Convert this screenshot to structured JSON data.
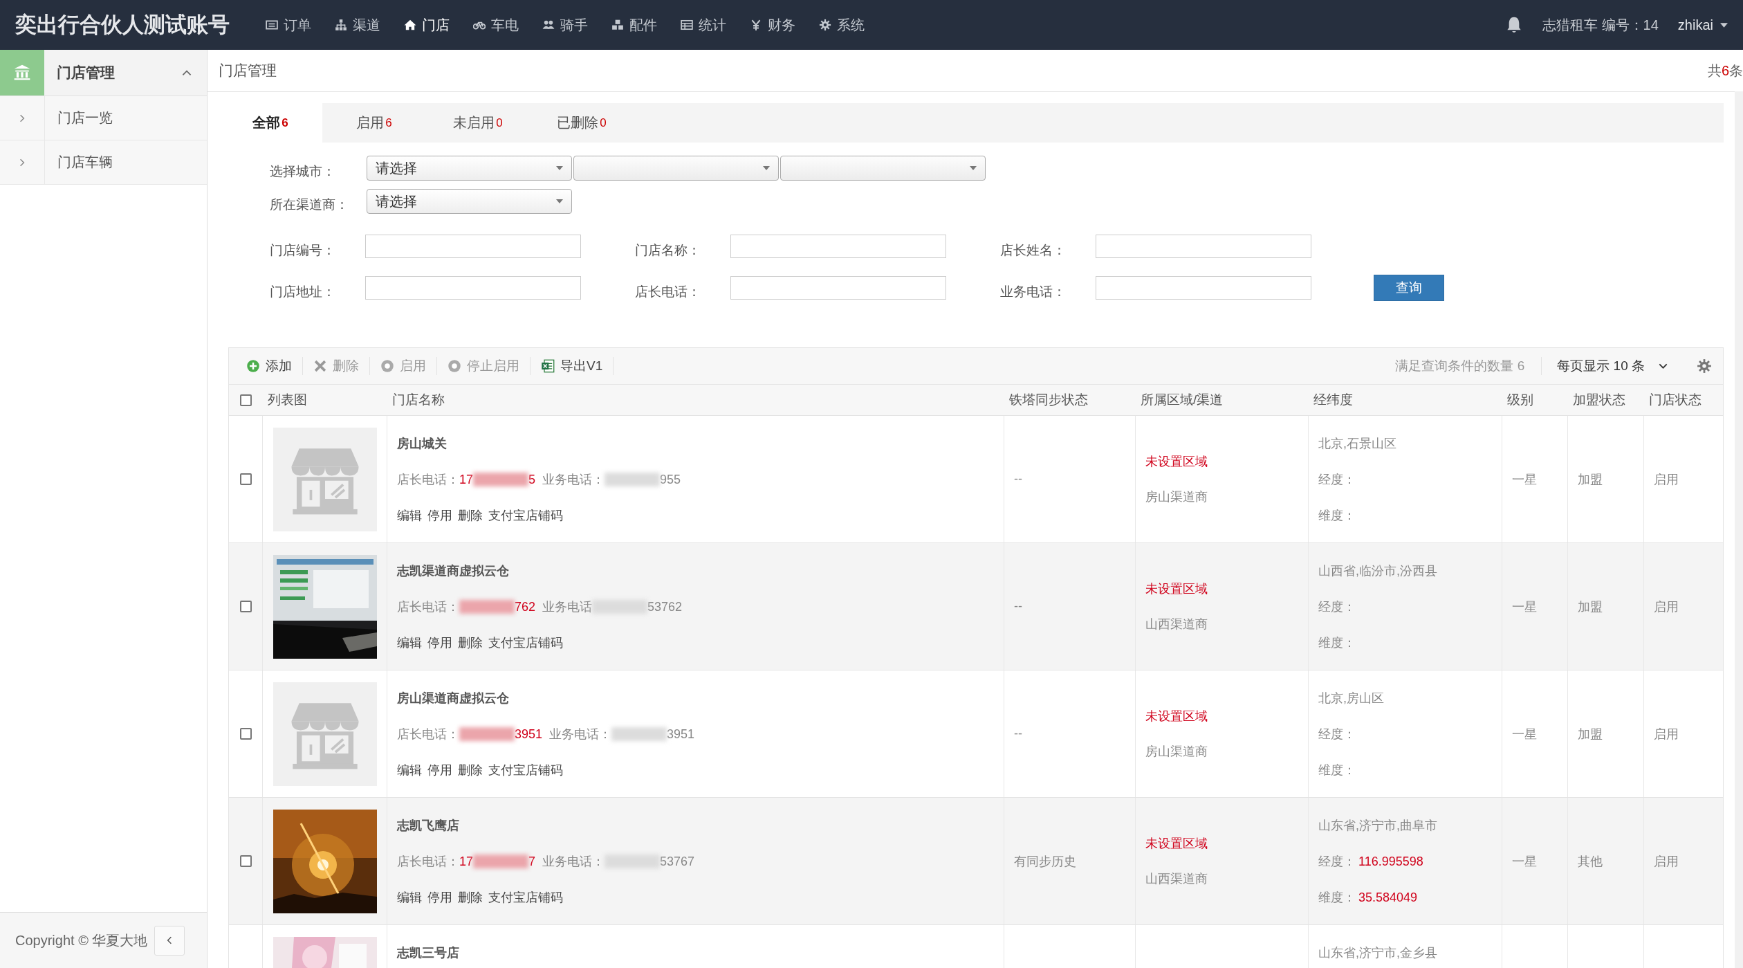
{
  "app": {
    "title": "奕出行合伙人测试账号"
  },
  "nav": [
    {
      "label": "订单",
      "selected": false
    },
    {
      "label": "渠道",
      "selected": false
    },
    {
      "label": "门店",
      "selected": true
    },
    {
      "label": "车电",
      "selected": false
    },
    {
      "label": "骑手",
      "selected": false
    },
    {
      "label": "配件",
      "selected": false
    },
    {
      "label": "统计",
      "selected": false
    },
    {
      "label": "财务",
      "selected": false
    },
    {
      "label": "系统",
      "selected": false
    }
  ],
  "user": {
    "account": "志猎租车 编号：14",
    "name": "zhikai"
  },
  "sidebar": {
    "section": {
      "label": "门店管理",
      "expanded": true
    },
    "items": [
      {
        "label": "门店一览"
      },
      {
        "label": "门店车辆"
      }
    ],
    "copyright": "Copyright © 华夏大地"
  },
  "breadcrumb": "门店管理",
  "total": {
    "prefix": "共",
    "count": "6",
    "suffix": "条"
  },
  "tabs": [
    {
      "label": "全部",
      "count": "6",
      "selected": true
    },
    {
      "label": "启用",
      "count": "6",
      "selected": false
    },
    {
      "label": "未启用",
      "count": "0",
      "selected": false
    },
    {
      "label": "已删除",
      "count": "0",
      "selected": false
    }
  ],
  "filters": {
    "city": {
      "label": "选择城市：",
      "selects": [
        {
          "kind": "choice",
          "value": "请选择"
        },
        {
          "kind": "blank"
        },
        {
          "kind": "blank"
        }
      ]
    },
    "channel": {
      "label": "所在渠道商：",
      "selects": [
        {
          "value": "请选择"
        }
      ]
    },
    "field_rows": [
      [
        {
          "label": "门店编号："
        },
        {
          "label": "门店名称："
        },
        {
          "label": "店长姓名："
        }
      ],
      [
        {
          "label": "门店地址："
        },
        {
          "label": "店长电话："
        },
        {
          "label": "业务电话："
        }
      ]
    ],
    "query_button": "查询"
  },
  "toolbar": {
    "actions": [
      {
        "label": "添加",
        "disabled": false
      },
      {
        "label": "删除",
        "disabled": true
      },
      {
        "label": "启用",
        "disabled": true
      },
      {
        "label": "停止启用",
        "disabled": true
      },
      {
        "label": "导出V1",
        "disabled": false
      }
    ],
    "match_count": "满足查询条件的数量 6",
    "page_size": "每页显示 10 条"
  },
  "table": {
    "header_checkbox": {
      "checked": false
    },
    "columns": [
      "列表图",
      "门店名称",
      "铁塔同步状态",
      "所属区域/渠道",
      "经纬度",
      "级别",
      "加盟状态",
      "门店状态"
    ],
    "rows": [
      {
        "checked": false,
        "thumbnail": {
          "kind": "store"
        },
        "name": "房山城关",
        "manager_label": "店长电话：",
        "manager_phone": {
          "start": "17",
          "end": "5"
        },
        "business_label": "业务电话：",
        "business_phone": {
          "end": "955"
        },
        "actions": [
          "编辑",
          "停用",
          "删除",
          "支付宝店铺码"
        ],
        "sync": "--",
        "region": "未设置区域",
        "channel": "房山渠道商",
        "location": "北京,石景山区",
        "lng_label": "经度：",
        "lat_label": "维度：",
        "level": "一星",
        "join": "加盟",
        "status": "启用"
      },
      {
        "checked": false,
        "thumbnail": {
          "kind": "screen-photo"
        },
        "name": "志凯渠道商虚拟云仓",
        "manager_label": "店长电话：",
        "manager_phone": {
          "end": "762"
        },
        "business_label": "业务电话",
        "business_phone": {
          "end": "53762"
        },
        "actions": [
          "编辑",
          "停用",
          "删除",
          "支付宝店铺码"
        ],
        "sync": "--",
        "region": "未设置区域",
        "channel": "山西渠道商",
        "location": "山西省,临汾市,汾西县",
        "lng_label": "经度：",
        "lat_label": "维度：",
        "level": "一星",
        "join": "加盟",
        "status": "启用"
      },
      {
        "checked": false,
        "thumbnail": {
          "kind": "store"
        },
        "name": "房山渠道商虚拟云仓",
        "manager_label": "店长电话：",
        "manager_phone": {
          "end": "3951"
        },
        "business_label": "业务电话：",
        "business_phone": {
          "end": "3951"
        },
        "actions": [
          "编辑",
          "停用",
          "删除",
          "支付宝店铺码"
        ],
        "sync": "--",
        "region": "未设置区域",
        "channel": "房山渠道商",
        "location": "北京,房山区",
        "lng_label": "经度：",
        "lat_label": "维度：",
        "level": "一星",
        "join": "加盟",
        "status": "启用"
      },
      {
        "checked": false,
        "thumbnail": {
          "kind": "sunset-photo"
        },
        "name": "志凯飞鹰店",
        "manager_label": "店长电话：",
        "manager_phone": {
          "start": "17",
          "end": "7"
        },
        "business_label": "业务电话：",
        "business_phone": {
          "end": "53767"
        },
        "actions": [
          "编辑",
          "停用",
          "删除",
          "支付宝店铺码"
        ],
        "sync": "有同步历史",
        "region": "未设置区域",
        "channel": "山西渠道商",
        "location": "山东省,济宁市,曲阜市",
        "lng_label": "经度：",
        "lng": "116.995598",
        "lat_label": "维度：",
        "lat": "35.584049",
        "level": "一星",
        "join": "其他",
        "status": "启用"
      },
      {
        "thumbnail": {
          "kind": "pink-photo"
        },
        "name": "志凯三号店",
        "location": "山东省,济宁市,金乡县"
      }
    ]
  }
}
